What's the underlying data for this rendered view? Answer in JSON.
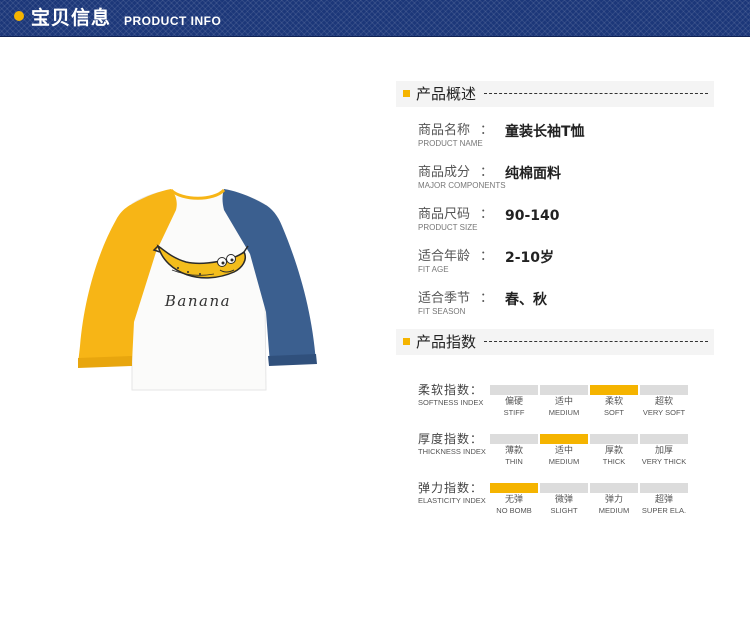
{
  "header": {
    "title": "宝贝信息",
    "subtitle": "PRODUCT INFO"
  },
  "shirt": {
    "print_text": "Banana",
    "colors": {
      "sleeve_left": "#f7b516",
      "sleeve_right": "#3b5f8f",
      "body": "#fbfbfa",
      "banana": "#f3bd1c"
    }
  },
  "overview": {
    "title": "产品概述",
    "rows": [
      {
        "label_cn": "商品名称",
        "label_en": "PRODUCT NAME",
        "value": "童装长袖T恤"
      },
      {
        "label_cn": "商品成分",
        "label_en": "MAJOR COMPONENTS",
        "value": "纯棉面料"
      },
      {
        "label_cn": "商品尺码",
        "label_en": "PRODUCT SIZE",
        "value": "90-140"
      },
      {
        "label_cn": "适合年龄",
        "label_en": "FIT AGE",
        "value": "2-10岁"
      },
      {
        "label_cn": "适合季节",
        "label_en": "FIT SEASON",
        "value": "春、秋"
      }
    ]
  },
  "indices": {
    "title": "产品指数",
    "rows": [
      {
        "label_cn": "柔软指数：",
        "label_en": "SOFTNESS INDEX",
        "selected": 2,
        "levels": [
          {
            "cn": "偏硬",
            "en": "STIFF"
          },
          {
            "cn": "适中",
            "en": "MEDIUM"
          },
          {
            "cn": "柔软",
            "en": "SOFT"
          },
          {
            "cn": "超软",
            "en": "VERY SOFT"
          }
        ]
      },
      {
        "label_cn": "厚度指数：",
        "label_en": "THICKNESS INDEX",
        "selected": 1,
        "levels": [
          {
            "cn": "薄款",
            "en": "THIN"
          },
          {
            "cn": "适中",
            "en": "MEDIUM"
          },
          {
            "cn": "厚款",
            "en": "THICK"
          },
          {
            "cn": "加厚",
            "en": "VERY THICK"
          }
        ]
      },
      {
        "label_cn": "弹力指数：",
        "label_en": "ELASTICITY INDEX",
        "selected": 0,
        "levels": [
          {
            "cn": "无弹",
            "en": "NO BOMB"
          },
          {
            "cn": "微弹",
            "en": "SLIGHT"
          },
          {
            "cn": "弹力",
            "en": "MEDIUM"
          },
          {
            "cn": "超弹",
            "en": "SUPER ELA."
          }
        ]
      }
    ]
  },
  "colors": {
    "header_bg": "#1c3779",
    "accent": "#f5b400",
    "bar_off": "#dcdcdc"
  }
}
